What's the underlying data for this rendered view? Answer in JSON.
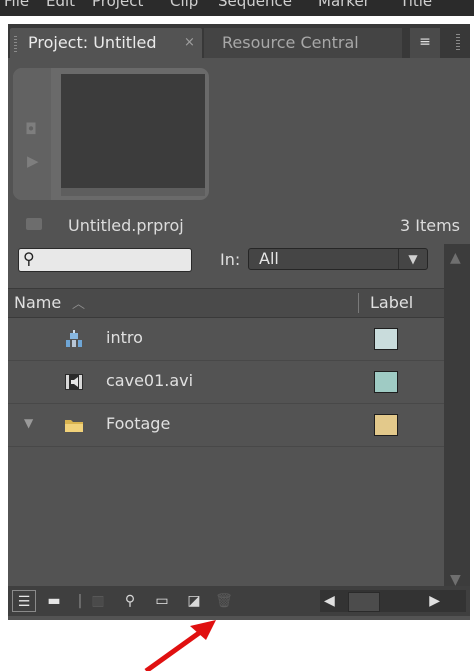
{
  "menu": {
    "items": [
      "File",
      "Edit",
      "Project",
      "Clip",
      "Sequence",
      "Marker",
      "Title"
    ]
  },
  "tabs": {
    "active_label": "Project: Untitled",
    "active_close": "×",
    "inactive_label": "Resource Central",
    "menu_icon": "≡"
  },
  "project": {
    "file_name": "Untitled.prproj",
    "item_count": "3 Items"
  },
  "filter": {
    "search_value": "",
    "in_label": "In:",
    "in_value": "All"
  },
  "columns": {
    "name": "Name",
    "label": "Label"
  },
  "items": [
    {
      "name": "intro",
      "icon": "sequence-icon",
      "label_color": "#c9dcdc"
    },
    {
      "name": "cave01.avi",
      "icon": "audio-video-clip-icon",
      "label_color": "#9fcbc4"
    },
    {
      "name": "Footage",
      "icon": "folder-icon",
      "label_color": "#e3c98b",
      "expandable": true
    }
  ],
  "colors": {
    "panel_bg": "#535353",
    "annotation_arrow": "#e01010"
  }
}
